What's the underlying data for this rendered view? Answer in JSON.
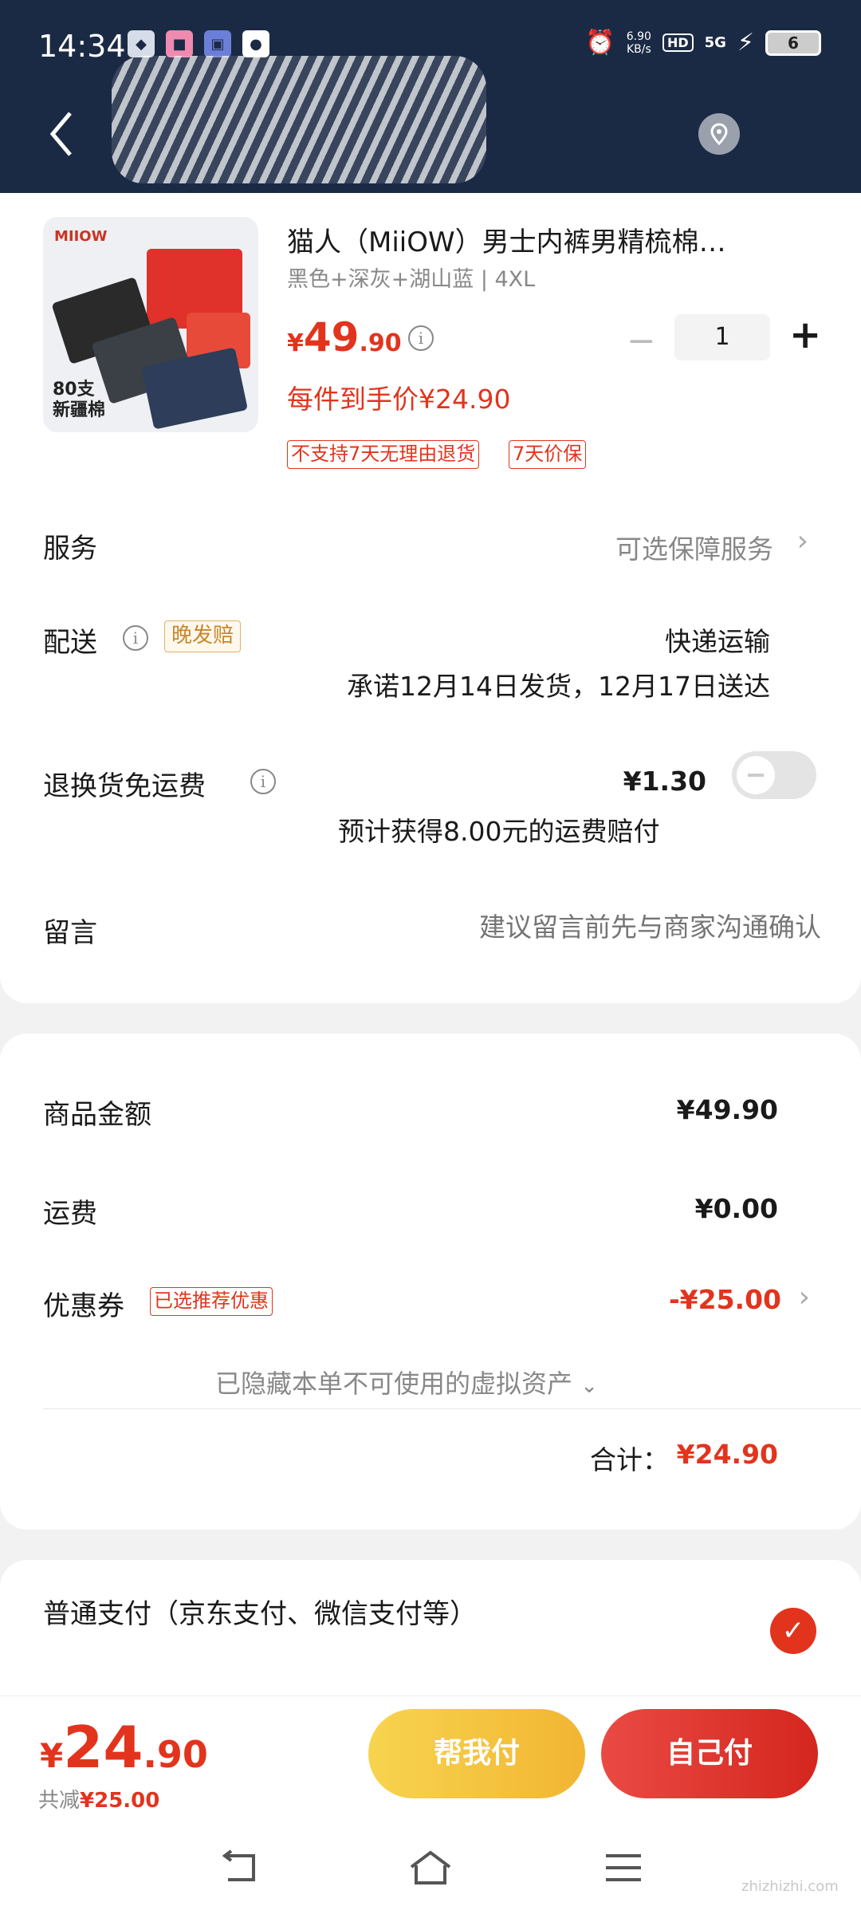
{
  "status": {
    "time": "14:34",
    "net_speed_top": "6.90",
    "net_speed_bottom": "KB/s",
    "hd": "HD",
    "signal": "5G",
    "battery": "6"
  },
  "product": {
    "title": "猫人（MiiOW）男士内裤男精梳棉…",
    "spec": "黑色+深灰+湖山蓝 | 4XL",
    "price_currency": "¥",
    "price_int": "49",
    "price_dec": ".90",
    "quantity": "1",
    "unit_price": "每件到手价¥24.90",
    "tags": [
      "不支持7天无理由退货",
      "7天价保"
    ],
    "image_brand": "MIIOW",
    "image_caption_1": "80支",
    "image_caption_2": "新疆棉"
  },
  "service": {
    "label": "服务",
    "value": "可选保障服务"
  },
  "delivery": {
    "label": "配送",
    "badge": "晚发赔",
    "method": "快递运输",
    "promise": "承诺12月14日发货，12月17日送达"
  },
  "return_shipping": {
    "label": "退换货免运费",
    "price": "¥1.30",
    "note": "预计获得8.00元的运费赔付"
  },
  "message": {
    "label": "留言",
    "placeholder": "建议留言前先与商家沟通确认"
  },
  "summary": {
    "goods_label": "商品金额",
    "goods_value": "¥49.90",
    "shipping_label": "运费",
    "shipping_value": "¥0.00",
    "coupon_label": "优惠券",
    "coupon_badge": "已选推荐优惠",
    "coupon_value": "-¥25.00",
    "hidden_assets": "已隐藏本单不可使用的虚拟资产",
    "total_label": "合计：",
    "total_value": "¥24.90"
  },
  "payment": {
    "option_label": "普通支付（京东支付、微信支付等）"
  },
  "bottom": {
    "price_currency": "¥",
    "price_int": "24",
    "price_dec": ".90",
    "save_label": "共减",
    "save_value": "¥25.00",
    "help_pay": "帮我付",
    "self_pay": "自己付"
  },
  "watermark": "zhizhizhi.com",
  "colors": {
    "accent": "#e2341d",
    "header": "#1b2a44",
    "help_btn": "#f2b532"
  }
}
